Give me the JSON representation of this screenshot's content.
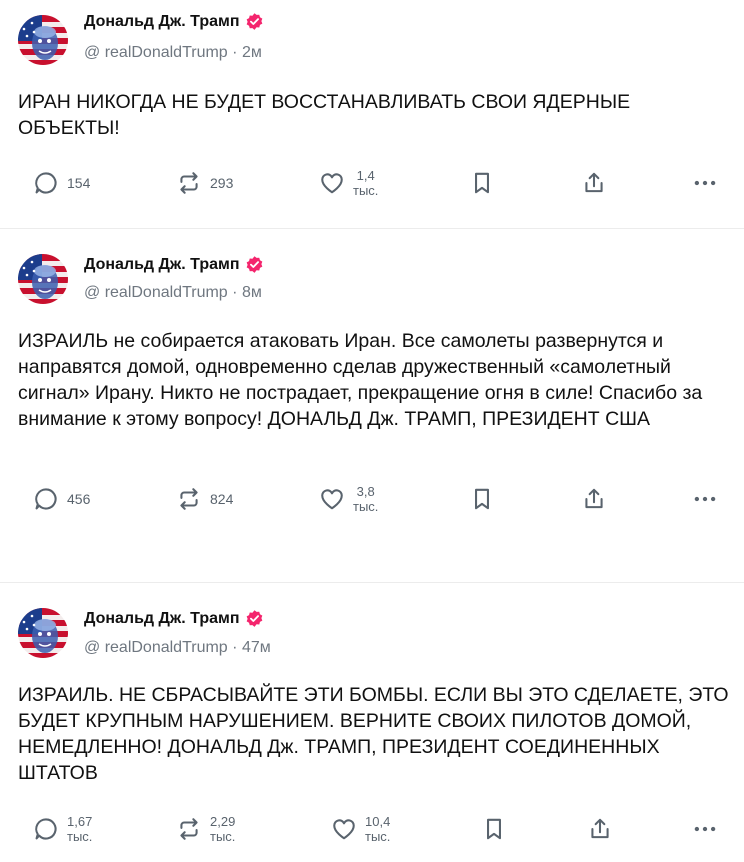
{
  "colors": {
    "badge": "#f4256d",
    "meta": "#6f7780",
    "icon": "#59636d"
  },
  "posts": [
    {
      "author": "Дональд Дж. Трамп",
      "handle": "@ realDonaldTrump",
      "sep": "·",
      "time": "2м",
      "text": "ИРАН НИКОГДА НЕ БУДЕТ ВОССТАНАВЛИВАТЬ СВОИ ЯДЕРНЫЕ ОБЪЕКТЫ!",
      "replies": "154",
      "reposts": "293",
      "likes_num": "1,4",
      "likes_unit": "тыс."
    },
    {
      "author": "Дональд Дж. Трамп",
      "handle": "@ realDonaldTrump",
      "sep": "·",
      "time": "8м",
      "text": "ИЗРАИЛЬ не собирается атаковать Иран. Все самолеты развернутся и направятся домой, одновременно сделав дружественный «самолетный сигнал» Ирану. Никто не пострадает, прекращение огня в силе! Спасибо за внимание к этому вопросу! ДОНАЛЬД Дж. ТРАМП, ПРЕЗИДЕНТ США",
      "replies": "456",
      "reposts": "824",
      "likes_num": "3,8",
      "likes_unit": "тыс."
    },
    {
      "author": "Дональд Дж. Трамп",
      "handle": "@ realDonaldTrump",
      "sep": "·",
      "time": "47м",
      "text": "ИЗРАИЛЬ. НЕ СБРАСЫВАЙТЕ ЭТИ БОМБЫ. ЕСЛИ ВЫ ЭТО СДЕЛАЕТЕ, ЭТО БУДЕТ КРУПНЫМ НАРУШЕНИЕМ. ВЕРНИТЕ СВОИХ ПИЛОТОВ ДОМОЙ, НЕМЕДЛЕННО! ДОНАЛЬД Дж. ТРАМП, ПРЕЗИДЕНТ СОЕДИНЕННЫХ ШТАТОВ",
      "replies_num": "1,67",
      "replies_unit": "тыс.",
      "reposts_num": "2,29",
      "reposts_unit": "тыс.",
      "likes_num": "10,4",
      "likes_unit": "тыс."
    }
  ],
  "icons": [
    "reply-icon",
    "repost-icon",
    "like-icon",
    "bookmark-icon",
    "share-icon",
    "more-icon",
    "verified-badge-icon"
  ]
}
